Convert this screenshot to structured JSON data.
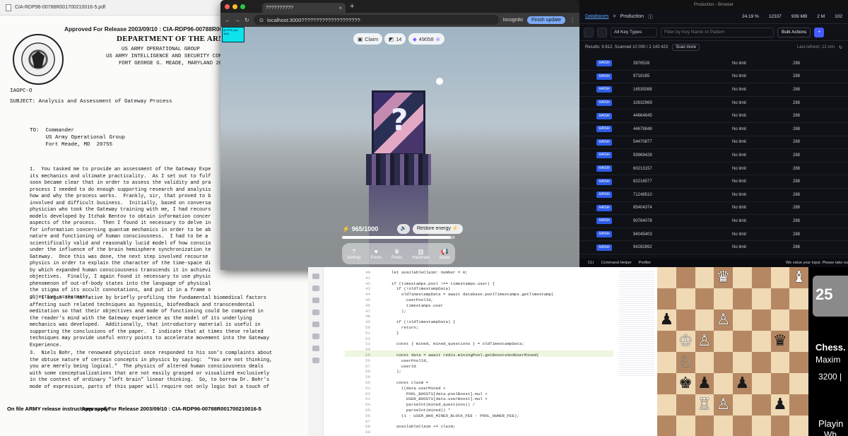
{
  "pdf": {
    "filename": "CIA-RDP96-00788R001700210016-5.pdf",
    "release_header": "Approved For Release 2003/09/10 : CIA-RDP96-00788R00170",
    "department": "DEPARTMENT OF THE ARMY",
    "org_lines": [
      "US ARMY OPERATIONAL GROUP",
      "US ARMY INTELLIGENCE AND SECURITY COMMAND",
      "FORT GEORGE G. MEADE, MARYLAND  20755"
    ],
    "ref": "IAGPC-O",
    "subject": "SUBJECT:  Analysis and Assessment of Gateway Process",
    "to_block": "TO:  Commander\n     US Army Operational Group\n     Fort Meade, MD  20755",
    "para1": "1.  You tasked me to provide an assessment of the Gateway Expe\nits mechanics and ultimate practicality.  As I set out to fulf\nsoon became clear that in order to assess the validity and pra\nprocess I needed to do enough supporting research and analysis\nhow and why the process works.  Frankly, sir, that proved to b\ninvolved and difficult business.  Initially, based on conversa\nphysician who took the Gateway training with me, I had recours\nmodels developed by Itzhak Bentov to obtain information concer\naspects of the process.  Then I found it necessary to delve in\nfor information concerning quantum mechanics in order to be ab\nnature and functioning of human consciousness.  I had to be a\nscientifically valid and reasonably lucid model of how conscio\nunder the influence of the brain hemisphere synchronization te\nGateway.  Once this was done, the next step involved recourse\nphysics in order to explain the character of the time-space di\nby which expanded human consciousness transcends it in achievi\nobjectives.  Finally, I again found it necessary to use physic\nphenomenon of out-of-body states into the language of physical\nthe stigma of its occult connotations, and put it in a frame o\nobjective assessment.",
    "para2": "2.  I began the narrative by briefly profiling the fundamental biomedical factors\naffecting such related techniques as hypnosis, biofeedback and transcendental\nmeditation so that their objectives and mode of functioning could be compared in\nthe reader's mind with the Gateway experience as the model of its underlying\nmechanics was developed.  Additionally, that introductory material is useful in\nsupporting the conclusions of the paper.  I indicate that at times these related\ntechniques may provide useful entry points to accelerate movement into the Gateway\nExperience.",
    "para3": "3.  Niels Bohr, the renowned physicist once responded to his son's complaints about\nthe obtuse nature of certain concepts in physics by saying:  \"You are not thinking,\nyou are merely being logical.\"  The physics of altered human consciousness deals\nwith some conceptualizations that are not easily grasped or visualized exclusively\nin the context of ordinary \"left brain\" linear thinking.  So, to borrow Dr. Bohr's\nmode of expression, parts of this paper will require not only logic but a touch of",
    "footer_left": "On file ARMY release instructions apply",
    "footer_right": "Approved For Release 2003/09/10 : CIA-RDP96-00788R001700210016-5"
  },
  "browser": {
    "tab_title": "??????????",
    "url": "localhost:3000????????????????????",
    "incognito": "Incognito",
    "finish_update": "Finish update",
    "colors": {
      "accent": "#7baaf7"
    }
  },
  "game": {
    "fps_label": "60 FPS (16-161)",
    "claim": "Claim",
    "level": "14",
    "balance": "49058",
    "energy": "965/1000",
    "energy_fraction": 0.965,
    "restore": "Restore energy",
    "nav": [
      {
        "icon": "?",
        "label": "Airdrop",
        "icon_name": "question-icon"
      },
      {
        "icon": "♥",
        "label": "Frens",
        "icon_name": "heart-icon"
      },
      {
        "icon": "♛",
        "label": "Pools",
        "icon_name": "trophy-icon"
      },
      {
        "icon": "▥",
        "label": "Hashrate",
        "icon_name": "bars-icon"
      },
      {
        "icon": "📢",
        "label": "News",
        "icon_name": "megaphone-icon"
      }
    ]
  },
  "db": {
    "window_title": "Production - Browser",
    "breadcrumb_link": "Databases",
    "breadcrumb_current": "Production",
    "stats": [
      "24.19 %",
      "12337",
      "939 MB",
      "2 M",
      "102"
    ],
    "key_types": "All Key Types",
    "filter_placeholder": "Filter by Key Name or Pattern",
    "bulk_actions": "Bulk Actions",
    "results": "Results: 9 812. Scanned 10 000 / 2 143 423",
    "scan_more": "Scan more",
    "last_refresh": "Last refresh: 12 min",
    "rows": [
      {
        "type": "HASH",
        "key": "3976528",
        "ttl": "No limit",
        "size": "288"
      },
      {
        "type": "HASH",
        "key": "9718165",
        "ttl": "No limit",
        "size": "288"
      },
      {
        "type": "HASH",
        "key": "16535088",
        "ttl": "No limit",
        "size": "288"
      },
      {
        "type": "HASH",
        "key": "32632969",
        "ttl": "No limit",
        "size": "288"
      },
      {
        "type": "HASH",
        "key": "44664645",
        "ttl": "No limit",
        "size": "288"
      },
      {
        "type": "HASH",
        "key": "44678848",
        "ttl": "No limit",
        "size": "288"
      },
      {
        "type": "HASH",
        "key": "54470877",
        "ttl": "No limit",
        "size": "288"
      },
      {
        "type": "HASH",
        "key": "59969428",
        "ttl": "No limit",
        "size": "288"
      },
      {
        "type": "HASH",
        "key": "60213157",
        "ttl": "No limit",
        "size": "288"
      },
      {
        "type": "HASH",
        "key": "62216577",
        "ttl": "No limit",
        "size": "288"
      },
      {
        "type": "HASH",
        "key": "71248510",
        "ttl": "No limit",
        "size": "288"
      },
      {
        "type": "HASH",
        "key": "85404374",
        "ttl": "No limit",
        "size": "288"
      },
      {
        "type": "HASH",
        "key": "90764078",
        "ttl": "No limit",
        "size": "288"
      },
      {
        "type": "HASH",
        "key": "94045403",
        "ttl": "No limit",
        "size": "288"
      },
      {
        "type": "HASH",
        "key": "94282892",
        "ttl": "No limit",
        "size": "288"
      }
    ],
    "status": {
      "cli": "CLI",
      "helper": "Command Helper",
      "profiler": "Profiler",
      "toast": "We value your input. Please take ou"
    }
  },
  "editor": {
    "lines": [
      {
        "n": "40",
        "t": "let availableClaim: number = 0;"
      },
      {
        "n": "41",
        "t": ""
      },
      {
        "n": "42",
        "t": "if (timestamps.pool !== timestamps.user) {"
      },
      {
        "n": "43",
        "t": "  if (!oldTimestampData)"
      },
      {
        "n": "44",
        "t": "    oldTimestampData = await database.poolTimestamps.getTimestamp("
      },
      {
        "n": "45",
        "t": "      userPoolId,"
      },
      {
        "n": "46",
        "t": "      timestamps.user"
      },
      {
        "n": "47",
        "t": "    );"
      },
      {
        "n": "48",
        "t": ""
      },
      {
        "n": "49",
        "t": "  if (!oldTimestampData) {"
      },
      {
        "n": "50",
        "t": "    return;"
      },
      {
        "n": "51",
        "t": "  }"
      },
      {
        "n": "52",
        "t": ""
      },
      {
        "n": "53",
        "t": "  const { mined, mined_questions } = oldTimestampData;"
      },
      {
        "n": "54",
        "t": ""
      },
      {
        "n": "55",
        "t": "  const data = await redis.miningPool.getBoostsAndUserMined("
      },
      {
        "n": "56",
        "t": "    userPoolId,"
      },
      {
        "n": "57",
        "t": "    userId"
      },
      {
        "n": "58",
        "t": "  );"
      },
      {
        "n": "59",
        "t": ""
      },
      {
        "n": "60",
        "t": "  const claim ="
      },
      {
        "n": "61",
        "t": "    ((data.userMined +"
      },
      {
        "n": "62",
        "t": "      POOL_BOOSTS[data.poolBoost].mul +"
      },
      {
        "n": "63",
        "t": "      USER_BOOSTS[data.userBoost].mul +"
      },
      {
        "n": "64",
        "t": "      parseInt(mined_questions)) /"
      },
      {
        "n": "65",
        "t": "      parseInt(mined)) *"
      },
      {
        "n": "66",
        "t": "    (1 - USER_WHO_MINED_BLOCK_FEE - POOL_OWNER_FEE);"
      },
      {
        "n": "67",
        "t": ""
      },
      {
        "n": "68",
        "t": "  availableClaim += claim;"
      },
      {
        "n": "69",
        "t": ""
      }
    ]
  },
  "chess": {
    "pieces": [
      {
        "c": 3,
        "r": 0,
        "g": "♛",
        "side": "w"
      },
      {
        "c": 7,
        "r": 0,
        "g": "♝",
        "side": "w"
      },
      {
        "c": 0,
        "r": 2,
        "g": "♟",
        "side": "b"
      },
      {
        "c": 3,
        "r": 2,
        "g": "♙",
        "side": "w"
      },
      {
        "c": 1,
        "r": 3,
        "g": "♔",
        "side": "w"
      },
      {
        "c": 2,
        "r": 3,
        "g": "♙",
        "side": "w"
      },
      {
        "c": 6,
        "r": 3,
        "g": "♛",
        "side": "b"
      },
      {
        "c": 1,
        "r": 4,
        "g": "♘",
        "side": "w"
      },
      {
        "c": 1,
        "r": 5,
        "g": "♚",
        "side": "b"
      },
      {
        "c": 2,
        "r": 5,
        "g": "♟",
        "side": "b"
      },
      {
        "c": 4,
        "r": 5,
        "g": "♟",
        "side": "b"
      },
      {
        "c": 2,
        "r": 6,
        "g": "♖",
        "side": "w"
      },
      {
        "c": 3,
        "r": 6,
        "g": "♙",
        "side": "w"
      },
      {
        "c": 6,
        "r": 6,
        "g": "♟",
        "side": "b"
      }
    ],
    "colors": {
      "light": "#f0d9b5",
      "dark": "#b58863"
    }
  },
  "video": {
    "badge": "25",
    "title": "Chess.",
    "subtitle": "Maxim",
    "rating": "3200 |",
    "line4": "Playin",
    "line5": "Wh"
  }
}
